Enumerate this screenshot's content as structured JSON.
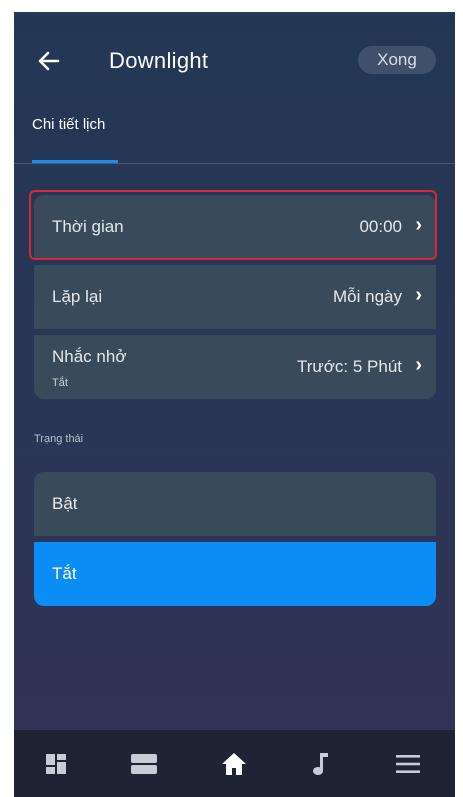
{
  "header": {
    "title": "Downlight",
    "done_label": "Xong"
  },
  "tabs": [
    {
      "label": "Chi tiết lịch",
      "active": true
    }
  ],
  "settings": [
    {
      "label": "Thời gian",
      "value": "00:00"
    },
    {
      "label": "Lặp lại",
      "value": "Mỗi ngày"
    },
    {
      "label": "Nhắc nhở",
      "sublabel": "Tắt",
      "value": "Trước: 5 Phút"
    }
  ],
  "status": {
    "section_label": "Trạng thái",
    "options": [
      {
        "label": "Bật",
        "selected": false
      },
      {
        "label": "Tắt",
        "selected": true
      }
    ]
  },
  "bottom_nav": [
    {
      "icon": "dashboard-icon"
    },
    {
      "icon": "list-icon"
    },
    {
      "icon": "home-icon",
      "active": true
    },
    {
      "icon": "music-icon"
    },
    {
      "icon": "menu-icon"
    }
  ],
  "colors": {
    "accent": "#0a8ef5",
    "row_bg": "#394b5b",
    "highlight": "#d7263d",
    "bottom_bar": "#1f2435"
  }
}
